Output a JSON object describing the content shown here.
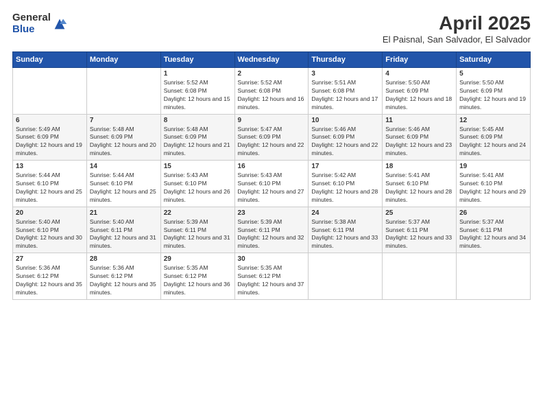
{
  "logo": {
    "general": "General",
    "blue": "Blue"
  },
  "header": {
    "month_year": "April 2025",
    "location": "El Paisnal, San Salvador, El Salvador"
  },
  "weekdays": [
    "Sunday",
    "Monday",
    "Tuesday",
    "Wednesday",
    "Thursday",
    "Friday",
    "Saturday"
  ],
  "weeks": [
    [
      {
        "day": "",
        "sunrise": "",
        "sunset": "",
        "daylight": ""
      },
      {
        "day": "",
        "sunrise": "",
        "sunset": "",
        "daylight": ""
      },
      {
        "day": "1",
        "sunrise": "Sunrise: 5:52 AM",
        "sunset": "Sunset: 6:08 PM",
        "daylight": "Daylight: 12 hours and 15 minutes."
      },
      {
        "day": "2",
        "sunrise": "Sunrise: 5:52 AM",
        "sunset": "Sunset: 6:08 PM",
        "daylight": "Daylight: 12 hours and 16 minutes."
      },
      {
        "day": "3",
        "sunrise": "Sunrise: 5:51 AM",
        "sunset": "Sunset: 6:08 PM",
        "daylight": "Daylight: 12 hours and 17 minutes."
      },
      {
        "day": "4",
        "sunrise": "Sunrise: 5:50 AM",
        "sunset": "Sunset: 6:09 PM",
        "daylight": "Daylight: 12 hours and 18 minutes."
      },
      {
        "day": "5",
        "sunrise": "Sunrise: 5:50 AM",
        "sunset": "Sunset: 6:09 PM",
        "daylight": "Daylight: 12 hours and 19 minutes."
      }
    ],
    [
      {
        "day": "6",
        "sunrise": "Sunrise: 5:49 AM",
        "sunset": "Sunset: 6:09 PM",
        "daylight": "Daylight: 12 hours and 19 minutes."
      },
      {
        "day": "7",
        "sunrise": "Sunrise: 5:48 AM",
        "sunset": "Sunset: 6:09 PM",
        "daylight": "Daylight: 12 hours and 20 minutes."
      },
      {
        "day": "8",
        "sunrise": "Sunrise: 5:48 AM",
        "sunset": "Sunset: 6:09 PM",
        "daylight": "Daylight: 12 hours and 21 minutes."
      },
      {
        "day": "9",
        "sunrise": "Sunrise: 5:47 AM",
        "sunset": "Sunset: 6:09 PM",
        "daylight": "Daylight: 12 hours and 22 minutes."
      },
      {
        "day": "10",
        "sunrise": "Sunrise: 5:46 AM",
        "sunset": "Sunset: 6:09 PM",
        "daylight": "Daylight: 12 hours and 22 minutes."
      },
      {
        "day": "11",
        "sunrise": "Sunrise: 5:46 AM",
        "sunset": "Sunset: 6:09 PM",
        "daylight": "Daylight: 12 hours and 23 minutes."
      },
      {
        "day": "12",
        "sunrise": "Sunrise: 5:45 AM",
        "sunset": "Sunset: 6:09 PM",
        "daylight": "Daylight: 12 hours and 24 minutes."
      }
    ],
    [
      {
        "day": "13",
        "sunrise": "Sunrise: 5:44 AM",
        "sunset": "Sunset: 6:10 PM",
        "daylight": "Daylight: 12 hours and 25 minutes."
      },
      {
        "day": "14",
        "sunrise": "Sunrise: 5:44 AM",
        "sunset": "Sunset: 6:10 PM",
        "daylight": "Daylight: 12 hours and 25 minutes."
      },
      {
        "day": "15",
        "sunrise": "Sunrise: 5:43 AM",
        "sunset": "Sunset: 6:10 PM",
        "daylight": "Daylight: 12 hours and 26 minutes."
      },
      {
        "day": "16",
        "sunrise": "Sunrise: 5:43 AM",
        "sunset": "Sunset: 6:10 PM",
        "daylight": "Daylight: 12 hours and 27 minutes."
      },
      {
        "day": "17",
        "sunrise": "Sunrise: 5:42 AM",
        "sunset": "Sunset: 6:10 PM",
        "daylight": "Daylight: 12 hours and 28 minutes."
      },
      {
        "day": "18",
        "sunrise": "Sunrise: 5:41 AM",
        "sunset": "Sunset: 6:10 PM",
        "daylight": "Daylight: 12 hours and 28 minutes."
      },
      {
        "day": "19",
        "sunrise": "Sunrise: 5:41 AM",
        "sunset": "Sunset: 6:10 PM",
        "daylight": "Daylight: 12 hours and 29 minutes."
      }
    ],
    [
      {
        "day": "20",
        "sunrise": "Sunrise: 5:40 AM",
        "sunset": "Sunset: 6:10 PM",
        "daylight": "Daylight: 12 hours and 30 minutes."
      },
      {
        "day": "21",
        "sunrise": "Sunrise: 5:40 AM",
        "sunset": "Sunset: 6:11 PM",
        "daylight": "Daylight: 12 hours and 31 minutes."
      },
      {
        "day": "22",
        "sunrise": "Sunrise: 5:39 AM",
        "sunset": "Sunset: 6:11 PM",
        "daylight": "Daylight: 12 hours and 31 minutes."
      },
      {
        "day": "23",
        "sunrise": "Sunrise: 5:39 AM",
        "sunset": "Sunset: 6:11 PM",
        "daylight": "Daylight: 12 hours and 32 minutes."
      },
      {
        "day": "24",
        "sunrise": "Sunrise: 5:38 AM",
        "sunset": "Sunset: 6:11 PM",
        "daylight": "Daylight: 12 hours and 33 minutes."
      },
      {
        "day": "25",
        "sunrise": "Sunrise: 5:37 AM",
        "sunset": "Sunset: 6:11 PM",
        "daylight": "Daylight: 12 hours and 33 minutes."
      },
      {
        "day": "26",
        "sunrise": "Sunrise: 5:37 AM",
        "sunset": "Sunset: 6:11 PM",
        "daylight": "Daylight: 12 hours and 34 minutes."
      }
    ],
    [
      {
        "day": "27",
        "sunrise": "Sunrise: 5:36 AM",
        "sunset": "Sunset: 6:12 PM",
        "daylight": "Daylight: 12 hours and 35 minutes."
      },
      {
        "day": "28",
        "sunrise": "Sunrise: 5:36 AM",
        "sunset": "Sunset: 6:12 PM",
        "daylight": "Daylight: 12 hours and 35 minutes."
      },
      {
        "day": "29",
        "sunrise": "Sunrise: 5:35 AM",
        "sunset": "Sunset: 6:12 PM",
        "daylight": "Daylight: 12 hours and 36 minutes."
      },
      {
        "day": "30",
        "sunrise": "Sunrise: 5:35 AM",
        "sunset": "Sunset: 6:12 PM",
        "daylight": "Daylight: 12 hours and 37 minutes."
      },
      {
        "day": "",
        "sunrise": "",
        "sunset": "",
        "daylight": ""
      },
      {
        "day": "",
        "sunrise": "",
        "sunset": "",
        "daylight": ""
      },
      {
        "day": "",
        "sunrise": "",
        "sunset": "",
        "daylight": ""
      }
    ]
  ]
}
